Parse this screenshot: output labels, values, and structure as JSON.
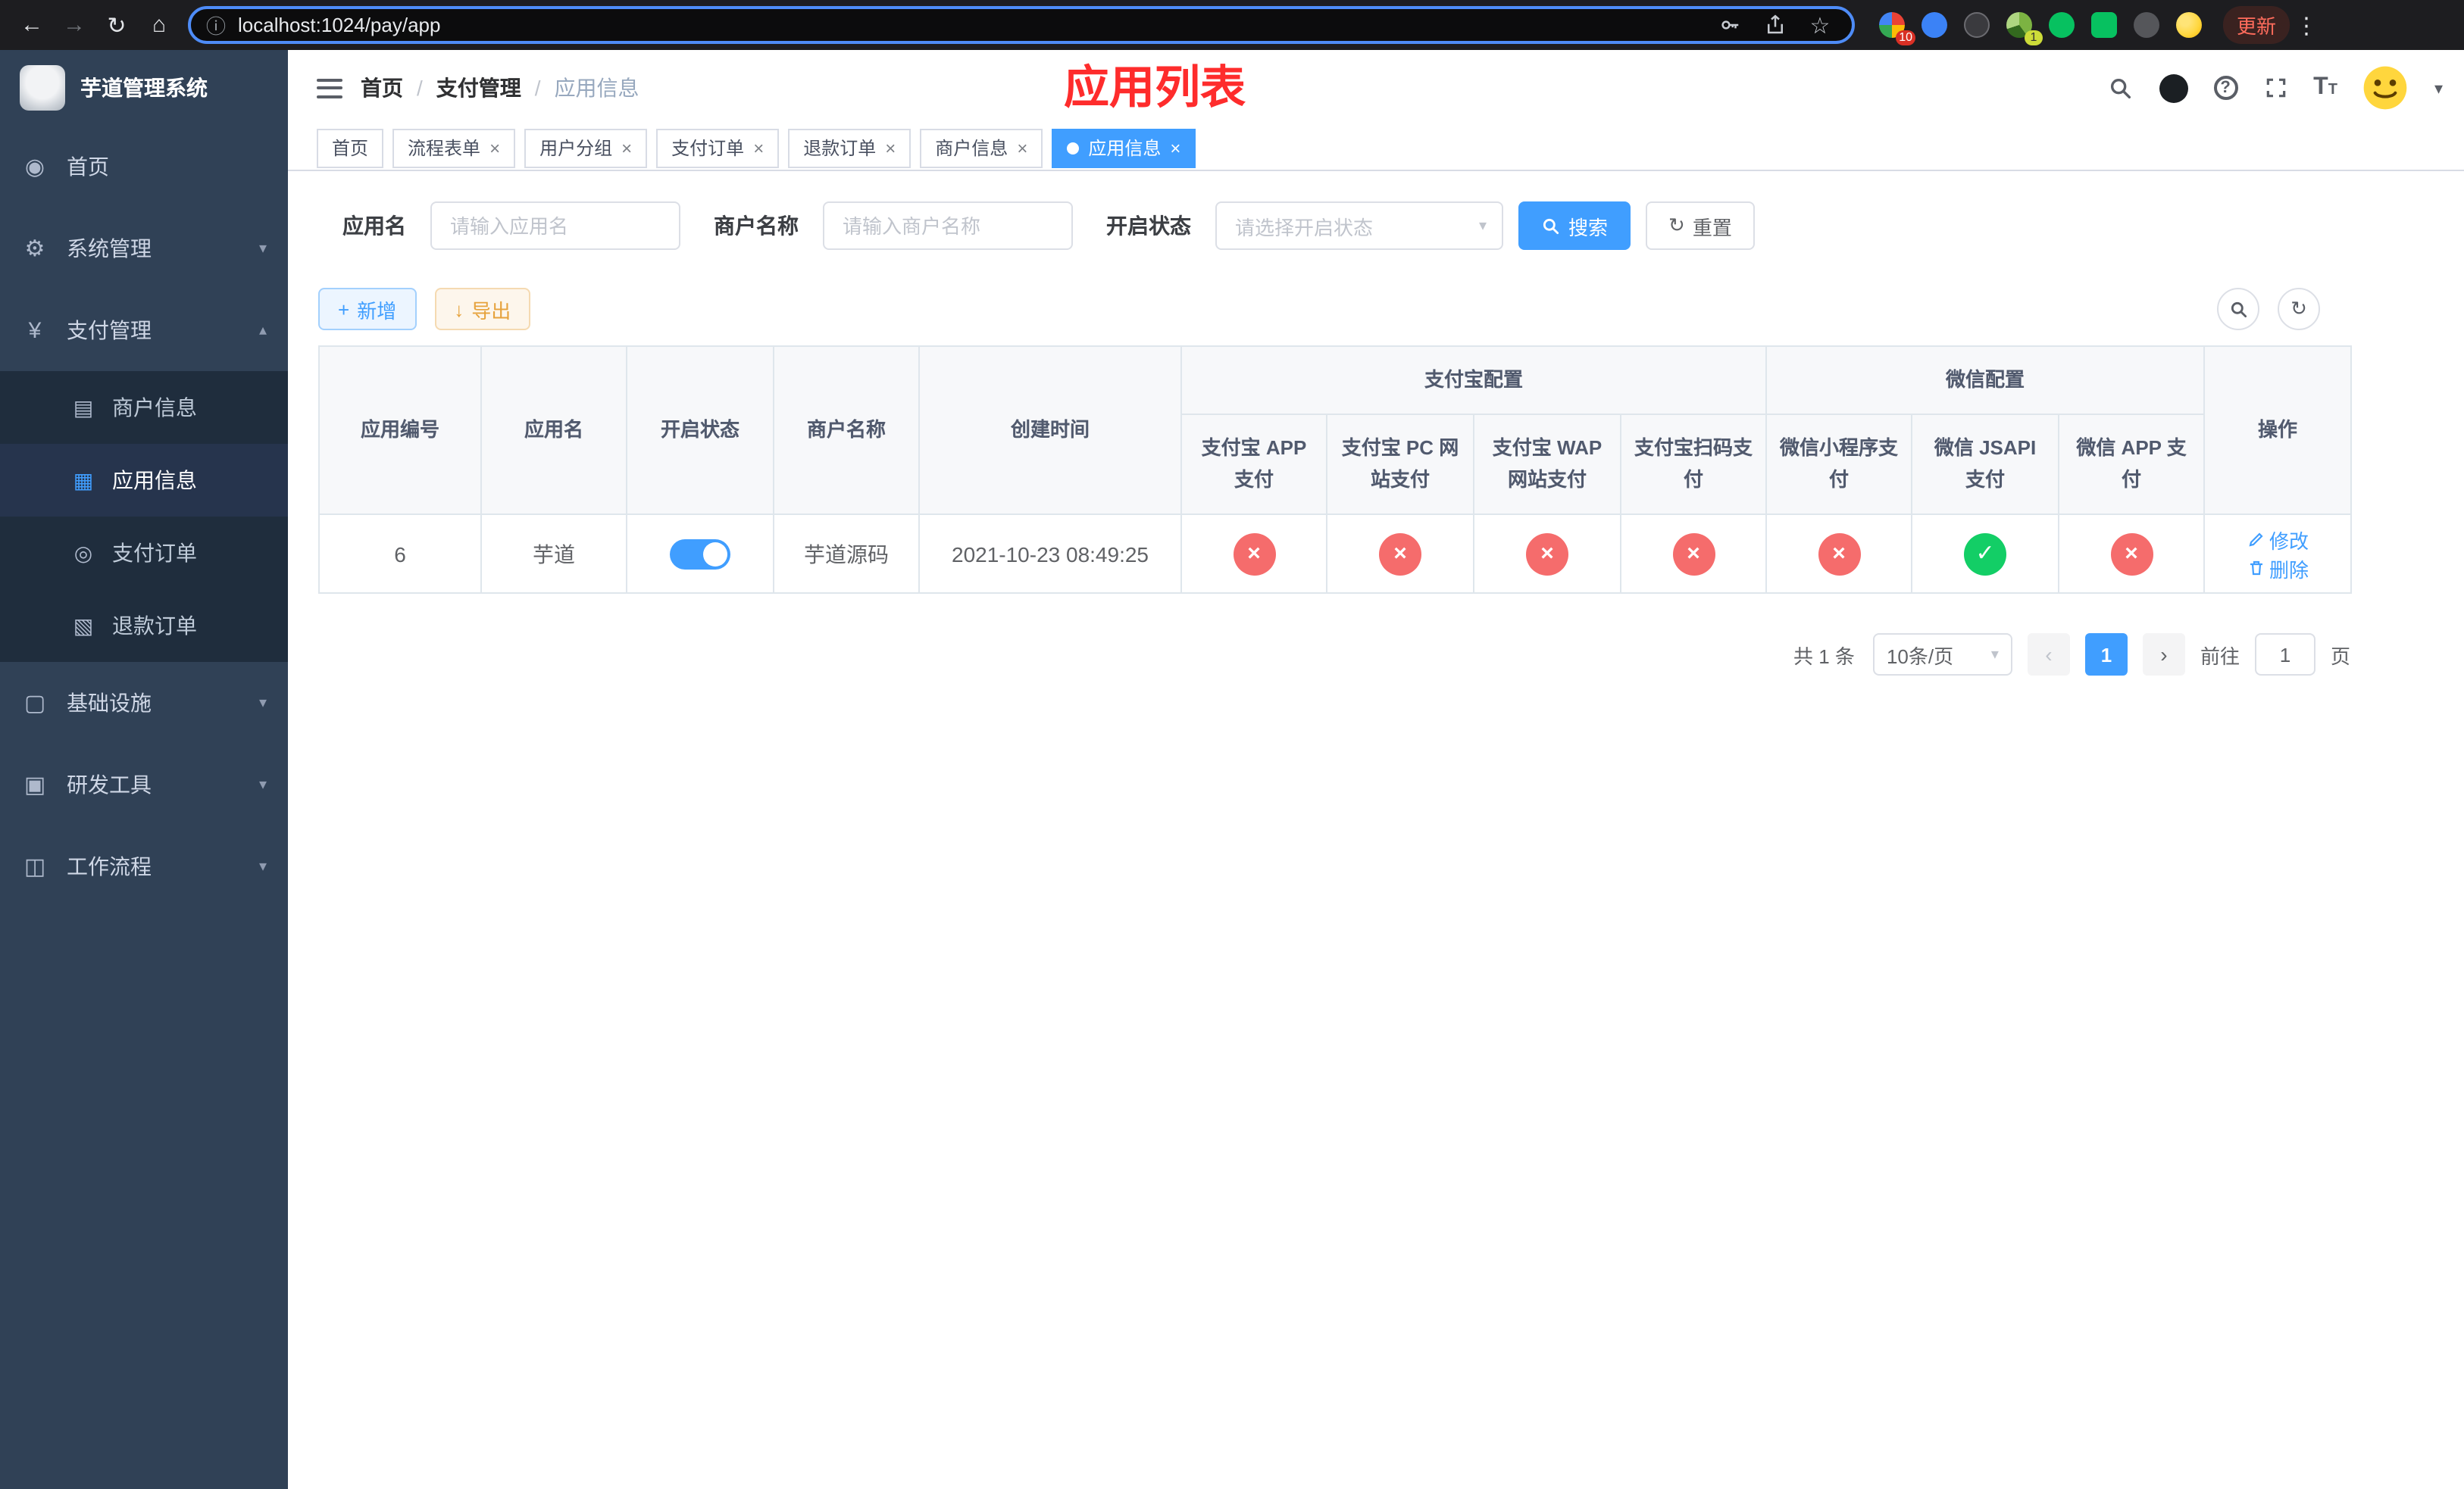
{
  "icons": {
    "back": "←",
    "forward": "→",
    "reload": "↻",
    "home": "⌂",
    "info": "ⓘ",
    "star": "☆",
    "menu_dots": "⋮",
    "dashboard": "◉",
    "gear": "⚙",
    "yen": "¥",
    "merchant": "▤",
    "app": "▦",
    "order": "◎",
    "refund": "▧",
    "infra": "▢",
    "tools": "▣",
    "workflow": "◫",
    "chevron_down": "▾",
    "chevron_up": "▴",
    "caret_down": "▾",
    "plus": "+",
    "download": "↓",
    "refresh": "↻",
    "prev": "‹",
    "next": "›",
    "check": "✓",
    "cross": "×",
    "close": "×",
    "help": "?"
  },
  "browser": {
    "url": "localhost:1024/pay/app",
    "update_label": "更新",
    "extensions_badge_count": "10",
    "avatar_badge_count": "1"
  },
  "sidebar": {
    "title": "芋道管理系统",
    "menu": [
      {
        "label": "首页"
      },
      {
        "label": "系统管理"
      },
      {
        "label": "支付管理"
      },
      {
        "label": "基础设施"
      },
      {
        "label": "研发工具"
      },
      {
        "label": "工作流程"
      }
    ],
    "submenu": [
      {
        "label": "商户信息"
      },
      {
        "label": "应用信息"
      },
      {
        "label": "支付订单"
      },
      {
        "label": "退款订单"
      }
    ]
  },
  "header": {
    "breadcrumb": [
      "首页",
      "支付管理",
      "应用信息"
    ],
    "title": "应用列表"
  },
  "tabs": [
    {
      "label": "首页"
    },
    {
      "label": "流程表单"
    },
    {
      "label": "用户分组"
    },
    {
      "label": "支付订单"
    },
    {
      "label": "退款订单"
    },
    {
      "label": "商户信息"
    },
    {
      "label": "应用信息"
    }
  ],
  "filters": {
    "app_name_label": "应用名",
    "app_name_placeholder": "请输入应用名",
    "merchant_label": "商户名称",
    "merchant_placeholder": "请输入商户名称",
    "status_label": "开启状态",
    "status_placeholder": "请选择开启状态",
    "search_label": "搜索",
    "reset_label": "重置"
  },
  "toolbar": {
    "add_label": "新增",
    "export_label": "导出"
  },
  "table": {
    "headers": {
      "app_id": "应用编号",
      "app_name": "应用名",
      "status": "开启状态",
      "merchant": "商户名称",
      "created": "创建时间",
      "alipay_group": "支付宝配置",
      "wechat_group": "微信配置",
      "actions": "操作",
      "channels": [
        "支付宝 APP 支付",
        "支付宝 PC 网站支付",
        "支付宝 WAP 网站支付",
        "支付宝扫码支付",
        "微信小程序支付",
        "微信 JSAPI 支付",
        "微信 APP 支付"
      ]
    },
    "row": {
      "app_id": "6",
      "app_name": "芋道",
      "status_on": true,
      "merchant": "芋道源码",
      "created": "2021-10-23 08:49:25",
      "channels": [
        {
          "name": "支付宝 APP 支付",
          "enabled": false
        },
        {
          "name": "支付宝 PC 网站支付",
          "enabled": false
        },
        {
          "name": "支付宝 WAP 网站支付",
          "enabled": false
        },
        {
          "name": "支付宝扫码支付",
          "enabled": false
        },
        {
          "name": "微信小程序支付",
          "enabled": false
        },
        {
          "name": "微信 JSAPI 支付",
          "enabled": true
        },
        {
          "name": "微信 APP 支付",
          "enabled": false
        }
      ],
      "edit_label": "修改",
      "delete_label": "删除"
    }
  },
  "pagination": {
    "total_label": "共 1 条",
    "page_size": "10条/页",
    "current_page": "1",
    "goto_label": "前往",
    "goto_value": "1",
    "page_unit": "页"
  }
}
